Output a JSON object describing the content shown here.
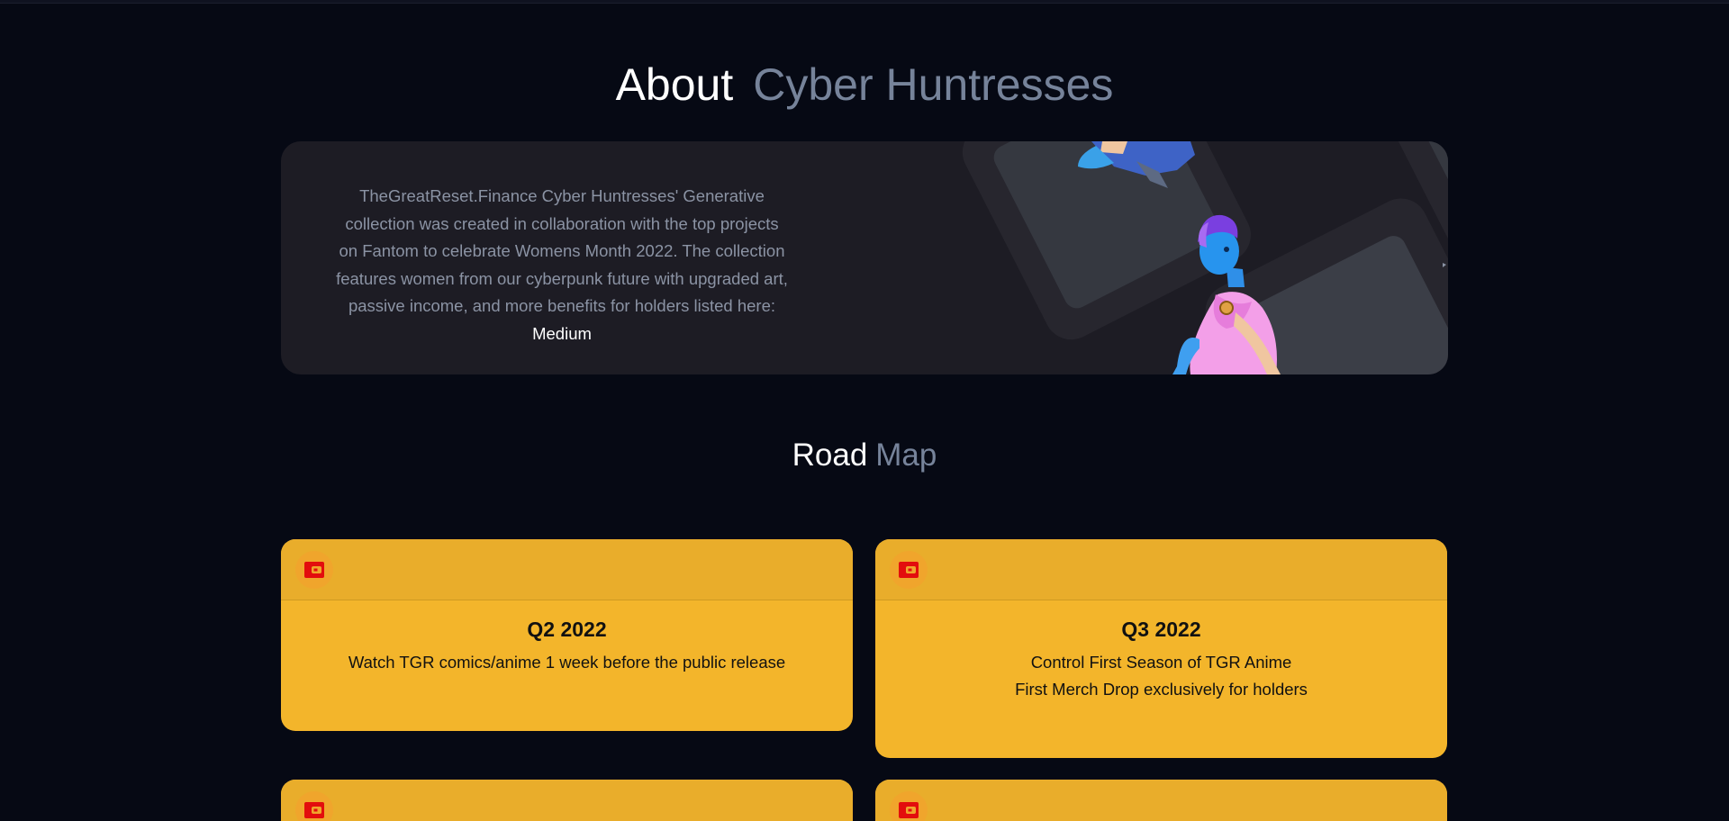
{
  "about": {
    "title_main": "About",
    "title_accent": "Cyber Huntresses",
    "paragraph": "TheGreatReset.Finance Cyber Huntresses' Generative collection was created in collaboration with the top projects on Fantom to celebrate Womens Month 2022. The collection features women from our cyberpunk future with upgraded art, passive income, and more benefits for holders listed here:",
    "link_label": "Medium"
  },
  "roadmap": {
    "title_main": "Road",
    "title_accent": "Map",
    "icon": "wallet-icon",
    "cards": [
      {
        "quarter": "Q2 2022",
        "lines": [
          "Watch TGR comics/anime 1 week before the public release"
        ]
      },
      {
        "quarter": "Q3 2022",
        "lines": [
          "Control First Season of TGR Anime",
          "First Merch Drop exclusively for holders"
        ]
      }
    ]
  },
  "colors": {
    "background": "#060914",
    "card_dark": "#1d1c24",
    "accent_gray": "#76839a",
    "roadmap_card": "#f3b52b",
    "icon_red": "#e30d0d"
  }
}
